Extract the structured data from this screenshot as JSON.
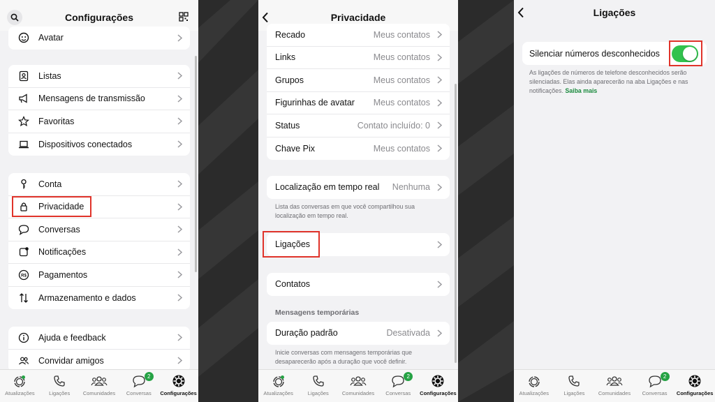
{
  "colors": {
    "accent": "#31c24d",
    "highlight": "#e0332a",
    "badge": "#25a244",
    "link": "#1a8a3d"
  },
  "screen1": {
    "header": {
      "title": "Configurações",
      "left_icon": "search-icon",
      "right_icon": "qr-code-icon"
    },
    "group0": [
      {
        "label": "Avatar",
        "icon": "avatar-icon"
      }
    ],
    "group1": [
      {
        "label": "Listas",
        "icon": "contact-list-icon"
      },
      {
        "label": "Mensagens de transmissão",
        "icon": "megaphone-icon"
      },
      {
        "label": "Favoritas",
        "icon": "star-icon"
      },
      {
        "label": "Dispositivos conectados",
        "icon": "laptop-icon"
      }
    ],
    "group2": [
      {
        "label": "Conta",
        "icon": "key-icon"
      },
      {
        "label": "Privacidade",
        "icon": "lock-icon"
      },
      {
        "label": "Conversas",
        "icon": "chat-bubble-icon"
      },
      {
        "label": "Notificações",
        "icon": "notification-icon"
      },
      {
        "label": "Pagamentos",
        "icon": "payment-icon"
      },
      {
        "label": "Armazenamento e dados",
        "icon": "data-transfer-icon"
      }
    ],
    "group3": [
      {
        "label": "Ajuda e feedback",
        "icon": "info-icon"
      },
      {
        "label": "Convidar amigos",
        "icon": "people-icon"
      }
    ]
  },
  "screen2": {
    "header": {
      "title": "Privacidade",
      "left_icon": "back-chevron-icon"
    },
    "group1": [
      {
        "label": "Recado",
        "value": "Meus contatos"
      },
      {
        "label": "Links",
        "value": "Meus contatos"
      },
      {
        "label": "Grupos",
        "value": "Meus contatos"
      },
      {
        "label": "Figurinhas de avatar",
        "value": "Meus contatos"
      },
      {
        "label": "Status",
        "value": "Contato incluído: 0"
      },
      {
        "label": "Chave Pix",
        "value": "Meus contatos"
      }
    ],
    "live_location": {
      "label": "Localização em tempo real",
      "value": "Nenhuma",
      "note": "Lista das conversas em que você compartilhou sua localização em tempo real."
    },
    "calls": {
      "label": "Ligações"
    },
    "contacts": {
      "label": "Contatos"
    },
    "temp_section": "Mensagens temporárias",
    "default_duration": {
      "label": "Duração padrão",
      "value": "Desativada",
      "note": "Inicie conversas com mensagens temporárias que desaparecerão após a duração que você definir."
    }
  },
  "screen3": {
    "header": {
      "title": "Ligações",
      "left_icon": "back-chevron-icon"
    },
    "silence": {
      "label": "Silenciar números desconhecidos",
      "enabled": true
    },
    "note": "As ligações de números de telefone desconhecidos serão silenciadas. Elas ainda aparecerão na aba Ligações e nas notificações.",
    "note_link": "Saiba mais"
  },
  "tabbar": {
    "tabs": [
      {
        "label": "Atualizações",
        "icon": "updates-icon"
      },
      {
        "label": "Ligações",
        "icon": "phone-icon"
      },
      {
        "label": "Comunidades",
        "icon": "communities-icon"
      },
      {
        "label": "Conversas",
        "icon": "chats-icon",
        "badge": "2"
      },
      {
        "label": "Configurações",
        "icon": "settings-gear-icon",
        "active": true
      }
    ]
  }
}
